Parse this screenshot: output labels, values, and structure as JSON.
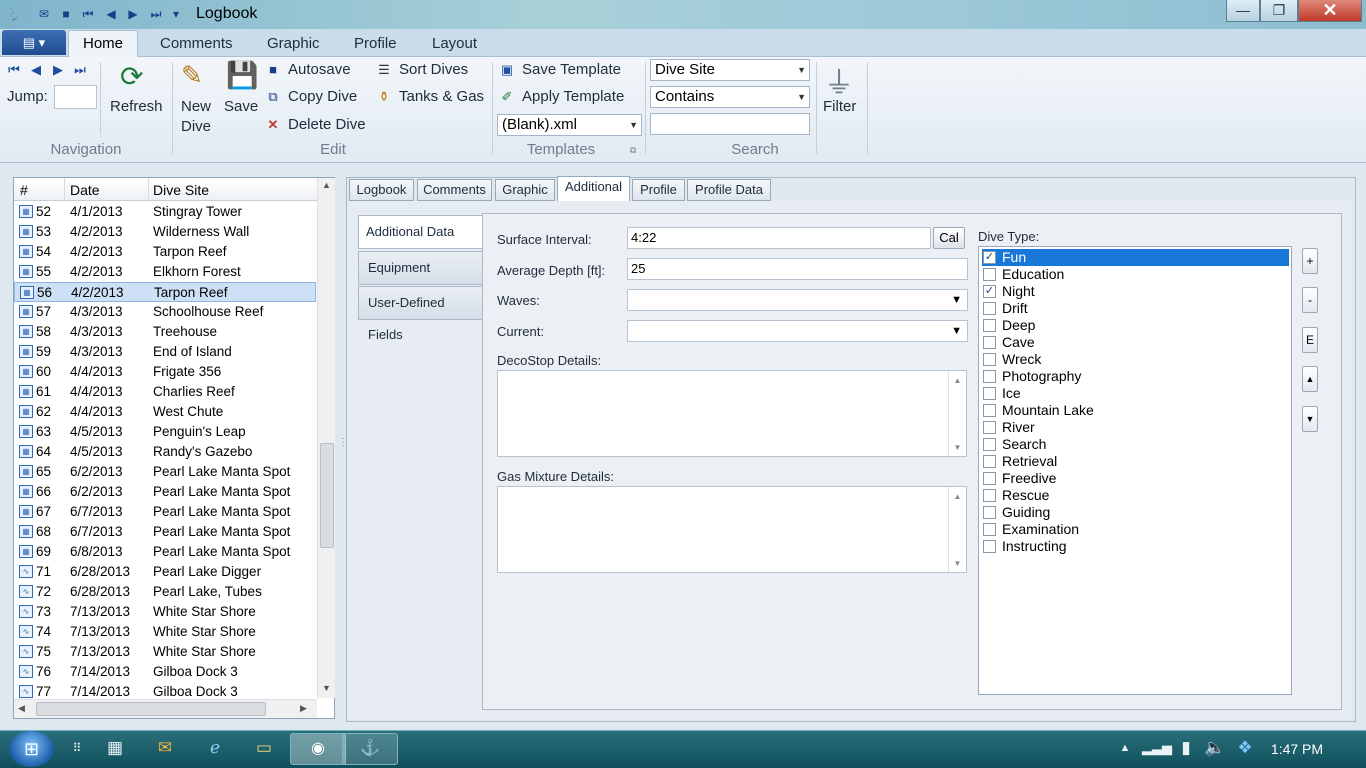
{
  "window": {
    "title": "Logbook"
  },
  "ribbon_tabs": [
    "Home",
    "Comments",
    "Graphic",
    "Profile",
    "Layout"
  ],
  "navigation": {
    "jump_label": "Jump:",
    "refresh": "Refresh",
    "group": "Navigation"
  },
  "edit": {
    "new_dive": [
      "New",
      "Dive"
    ],
    "save": "Save",
    "autosave": "Autosave",
    "copy_dive": "Copy Dive",
    "delete_dive": "Delete Dive",
    "sort_dives": "Sort Dives",
    "tanks_gas": "Tanks & Gas",
    "group": "Edit"
  },
  "templates": {
    "save_template": "Save Template",
    "apply_template": "Apply Template",
    "template_file": "(Blank).xml",
    "group": "Templates"
  },
  "search": {
    "field": "Dive Site",
    "operator": "Contains",
    "value": "",
    "group": "Search"
  },
  "filter": {
    "label": "Filter"
  },
  "dive_list": {
    "columns": [
      "#",
      "Date",
      "Dive Site"
    ],
    "selected_number": "56",
    "rows": [
      {
        "num": "52",
        "date": "4/1/2013",
        "site": "Stingray Tower",
        "icon": "table"
      },
      {
        "num": "53",
        "date": "4/2/2013",
        "site": "Wilderness Wall",
        "icon": "table"
      },
      {
        "num": "54",
        "date": "4/2/2013",
        "site": "Tarpon Reef",
        "icon": "table"
      },
      {
        "num": "55",
        "date": "4/2/2013",
        "site": "Elkhorn Forest",
        "icon": "table"
      },
      {
        "num": "56",
        "date": "4/2/2013",
        "site": "Tarpon Reef",
        "icon": "table"
      },
      {
        "num": "57",
        "date": "4/3/2013",
        "site": "Schoolhouse Reef",
        "icon": "table"
      },
      {
        "num": "58",
        "date": "4/3/2013",
        "site": "Treehouse",
        "icon": "table"
      },
      {
        "num": "59",
        "date": "4/3/2013",
        "site": "End of Island",
        "icon": "table"
      },
      {
        "num": "60",
        "date": "4/4/2013",
        "site": "Frigate 356",
        "icon": "table"
      },
      {
        "num": "61",
        "date": "4/4/2013",
        "site": "Charlies Reef",
        "icon": "table"
      },
      {
        "num": "62",
        "date": "4/4/2013",
        "site": "West Chute",
        "icon": "table"
      },
      {
        "num": "63",
        "date": "4/5/2013",
        "site": "Penguin's Leap",
        "icon": "table"
      },
      {
        "num": "64",
        "date": "4/5/2013",
        "site": "Randy's Gazebo",
        "icon": "table"
      },
      {
        "num": "65",
        "date": "6/2/2013",
        "site": "Pearl Lake Manta Spot",
        "icon": "table"
      },
      {
        "num": "66",
        "date": "6/2/2013",
        "site": "Pearl Lake Manta Spot",
        "icon": "table"
      },
      {
        "num": "67",
        "date": "6/7/2013",
        "site": "Pearl Lake Manta Spot",
        "icon": "table"
      },
      {
        "num": "68",
        "date": "6/7/2013",
        "site": "Pearl Lake Manta Spot",
        "icon": "table"
      },
      {
        "num": "69",
        "date": "6/8/2013",
        "site": "Pearl Lake Manta Spot",
        "icon": "table"
      },
      {
        "num": "71",
        "date": "6/28/2013",
        "site": "Pearl Lake Digger",
        "icon": "profile"
      },
      {
        "num": "72",
        "date": "6/28/2013",
        "site": "Pearl Lake, Tubes",
        "icon": "profile"
      },
      {
        "num": "73",
        "date": "7/13/2013",
        "site": "White Star Shore",
        "icon": "profile"
      },
      {
        "num": "74",
        "date": "7/13/2013",
        "site": "White Star Shore",
        "icon": "profile"
      },
      {
        "num": "75",
        "date": "7/13/2013",
        "site": "White Star Shore",
        "icon": "profile"
      },
      {
        "num": "76",
        "date": "7/14/2013",
        "site": "Gilboa Dock 3",
        "icon": "profile"
      },
      {
        "num": "77",
        "date": "7/14/2013",
        "site": "Gilboa Dock 3",
        "icon": "profile"
      }
    ]
  },
  "content_tabs": [
    "Logbook",
    "Comments",
    "Graphic",
    "Additional",
    "Profile",
    "Profile Data"
  ],
  "active_content_tab": "Additional",
  "side_tabs": [
    "Additional Data",
    "Equipment",
    "User-Defined Fields"
  ],
  "form": {
    "surface_interval_label": "Surface Interval:",
    "surface_interval": "4:22",
    "cal_button": "Cal",
    "avg_depth_label": "Average Depth [ft]:",
    "avg_depth": "25",
    "waves_label": "Waves:",
    "waves": "",
    "current_label": "Current:",
    "current": "",
    "decostop_label": "DecoStop Details:",
    "decostop": "",
    "gas_label": "Gas Mixture Details:",
    "gas": ""
  },
  "dive_type": {
    "label": "Dive Type:",
    "items": [
      {
        "label": "Fun",
        "checked": true,
        "selected": true
      },
      {
        "label": "Education",
        "checked": false
      },
      {
        "label": "Night",
        "checked": true
      },
      {
        "label": "Drift",
        "checked": false
      },
      {
        "label": "Deep",
        "checked": false
      },
      {
        "label": "Cave",
        "checked": false
      },
      {
        "label": "Wreck",
        "checked": false
      },
      {
        "label": "Photography",
        "checked": false
      },
      {
        "label": "Ice",
        "checked": false
      },
      {
        "label": "Mountain Lake",
        "checked": false
      },
      {
        "label": "River",
        "checked": false
      },
      {
        "label": "Search",
        "checked": false
      },
      {
        "label": "Retrieval",
        "checked": false
      },
      {
        "label": "Freedive",
        "checked": false
      },
      {
        "label": "Rescue",
        "checked": false
      },
      {
        "label": "Guiding",
        "checked": false
      },
      {
        "label": "Examination",
        "checked": false
      },
      {
        "label": "Instructing",
        "checked": false
      }
    ],
    "buttons": [
      "+",
      "-",
      "E",
      "▲",
      "▼"
    ]
  },
  "taskbar": {
    "clock": "1:47 PM"
  },
  "colors": {
    "selection": "#1877d8",
    "row_selected": "#cde0f6",
    "ribbon": "#e1eaf2",
    "taskbar": "#1f5f6b"
  }
}
